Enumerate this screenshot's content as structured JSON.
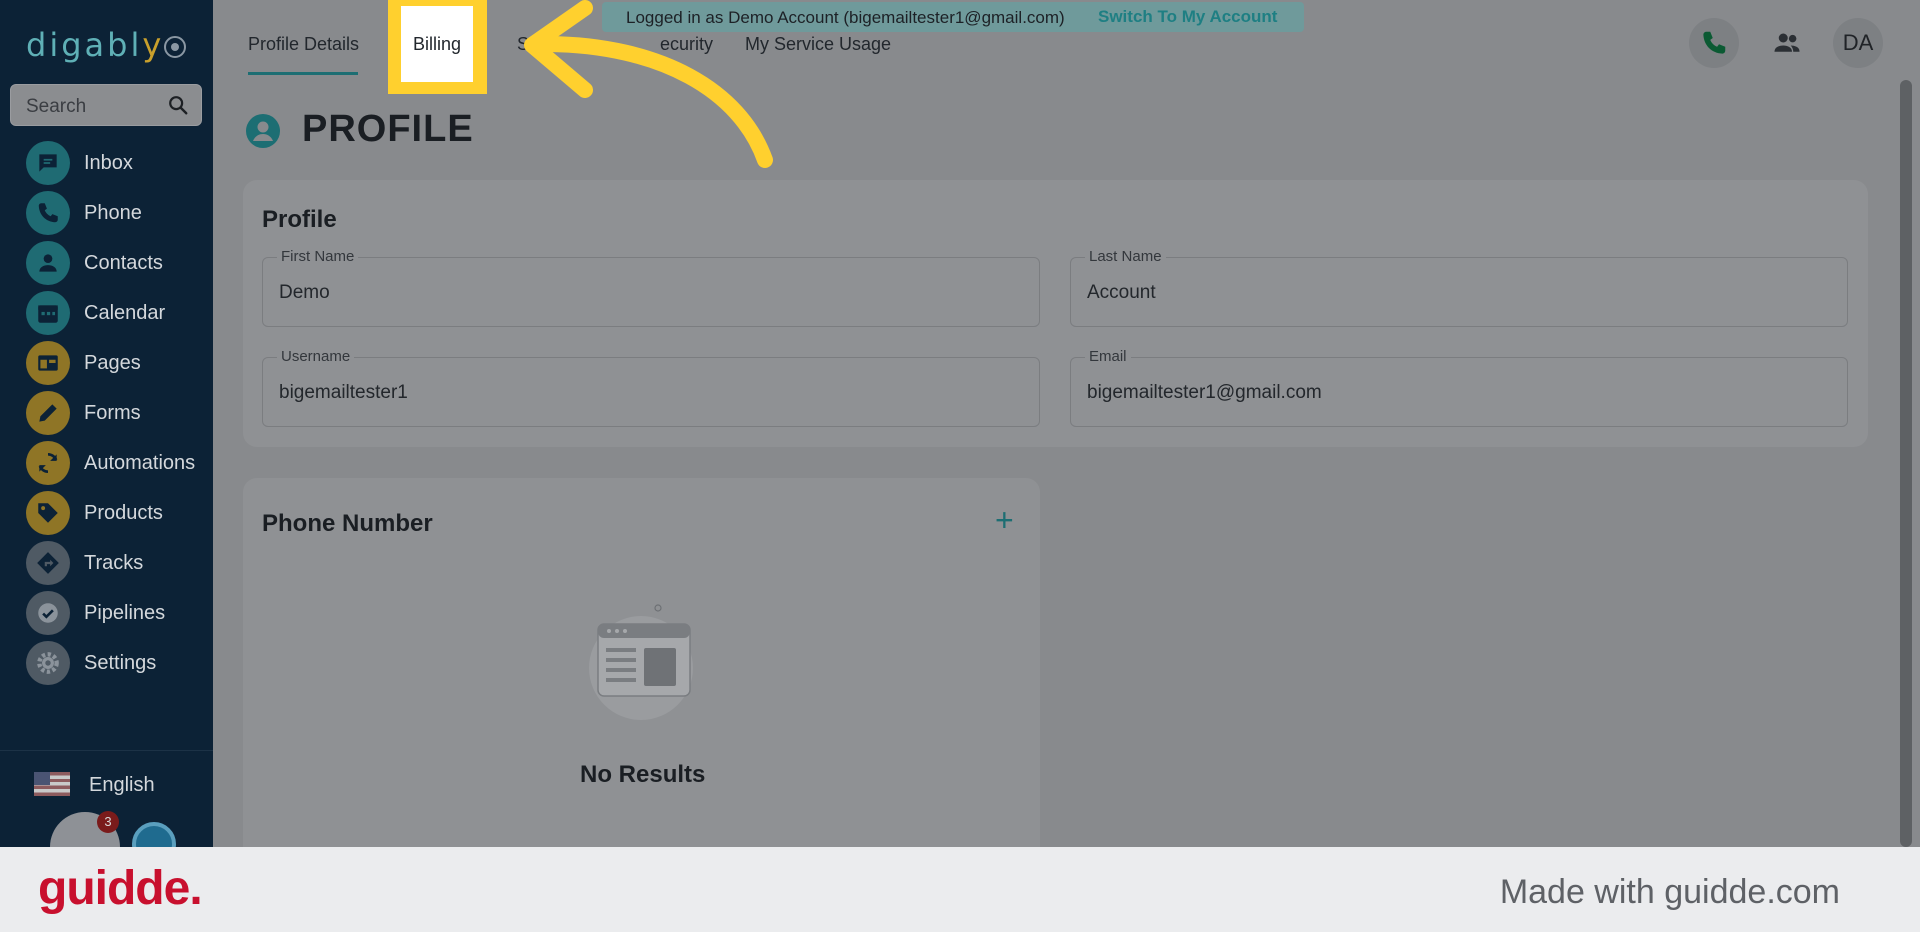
{
  "app": {
    "logo": "digably",
    "search_placeholder": "Search",
    "nav": [
      {
        "label": "Inbox"
      },
      {
        "label": "Phone"
      },
      {
        "label": "Contacts"
      },
      {
        "label": "Calendar"
      },
      {
        "label": "Pages"
      },
      {
        "label": "Forms"
      },
      {
        "label": "Automations"
      },
      {
        "label": "Products"
      },
      {
        "label": "Tracks"
      },
      {
        "label": "Pipelines"
      },
      {
        "label": "Settings"
      }
    ],
    "language": "English",
    "notification_count": "3"
  },
  "tabs": [
    {
      "label": "Profile Details",
      "active": true
    },
    {
      "label": "Billing",
      "active": false
    },
    {
      "label": "Se",
      "active": false
    },
    {
      "label": "ecurity",
      "active": false
    },
    {
      "label": "My Service Usage",
      "active": false
    }
  ],
  "banner": {
    "text": "Logged in as Demo Account (bigemailtester1@gmail.com)",
    "link": "Switch To My Account"
  },
  "header": {
    "avatar_initials": "DA"
  },
  "page": {
    "title": "PROFILE"
  },
  "profile_card": {
    "title": "Profile",
    "fields": {
      "first_name": {
        "label": "First Name",
        "value": "Demo"
      },
      "last_name": {
        "label": "Last Name",
        "value": "Account"
      },
      "username": {
        "label": "Username",
        "value": "bigemailtester1"
      },
      "email": {
        "label": "Email",
        "value": "bigemailtester1@gmail.com"
      }
    }
  },
  "phone_card": {
    "title": "Phone Number",
    "add_label": "+",
    "empty_text": "No Results"
  },
  "footer": {
    "brand": "guidde.",
    "text": "Made with guidde.com"
  },
  "colors": {
    "sidebar_bg": "#0c2236",
    "accent_teal": "#1d6e73",
    "highlight_yellow": "#ffd02e",
    "brand_red": "#c8102e"
  }
}
